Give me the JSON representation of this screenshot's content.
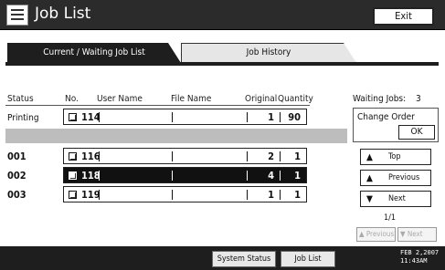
{
  "header": {
    "title": "Job List",
    "exit_label": "Exit"
  },
  "tabs": [
    {
      "label": "Current / Waiting Job List",
      "active": true
    },
    {
      "label": "Job History",
      "active": false
    }
  ],
  "columns": {
    "status": "Status",
    "no": "No.",
    "user": "User Name",
    "file": "File Name",
    "orig": "Original",
    "qty": "Quantity"
  },
  "rows": [
    {
      "status": "Printing",
      "no": "114",
      "original": "1",
      "quantity": "90",
      "selected": false
    },
    {
      "status": "001",
      "no": "116",
      "original": "2",
      "quantity": "1",
      "selected": false
    },
    {
      "status": "002",
      "no": "118",
      "original": "4",
      "quantity": "1",
      "selected": true
    },
    {
      "status": "003",
      "no": "119",
      "original": "1",
      "quantity": "1",
      "selected": false
    }
  ],
  "side": {
    "waiting_label": "Waiting Jobs:",
    "waiting_count": "3",
    "change_order": "Change Order",
    "ok": "OK",
    "top": "Top",
    "previous": "Previous",
    "next": "Next",
    "page": "1/1",
    "pg_prev": "Previous",
    "pg_next": "Next"
  },
  "bottom": {
    "system_status": "System Status",
    "job_list": "Job List",
    "date": "FEB  2,2007",
    "time": "11:43AM"
  }
}
